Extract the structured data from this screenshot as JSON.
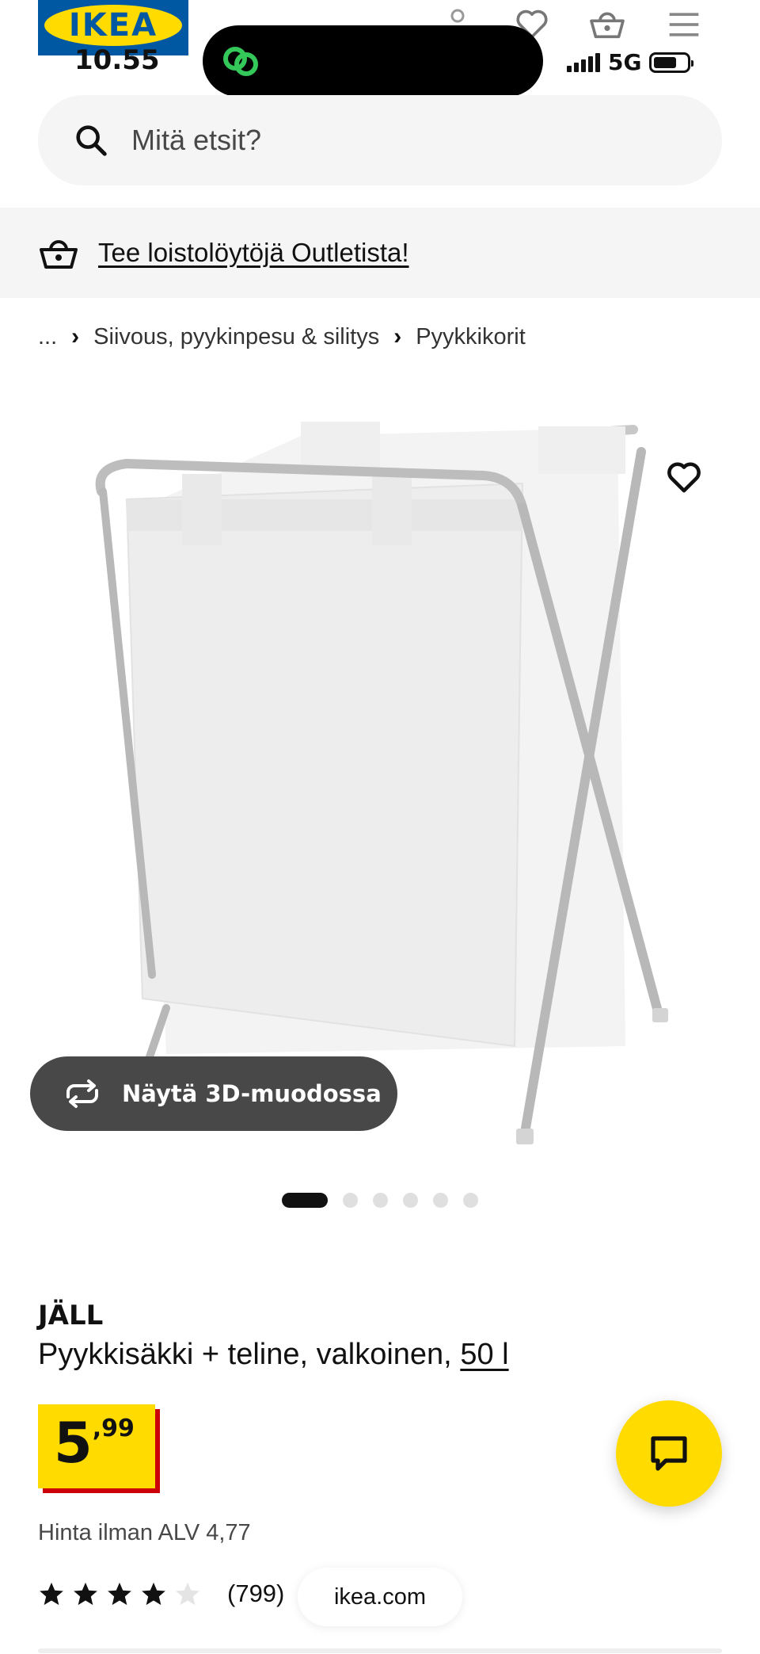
{
  "header": {
    "logo_text": "IKEA",
    "time": "10.55",
    "network": "5G",
    "icons": [
      "user-icon",
      "heart-icon",
      "basket-icon",
      "menu-icon"
    ]
  },
  "search": {
    "placeholder": "Mitä etsit?"
  },
  "banner": {
    "link_text": "Tee loistolöytöjä Outletista!",
    "icon": "basket-icon"
  },
  "breadcrumb": {
    "items": [
      "...",
      "Siivous, pyykinpesu & silitys",
      "Pyykkikorit"
    ]
  },
  "gallery": {
    "button_3d_label": "Näytä 3D-muodossa",
    "slide_count": 6,
    "active_slide": 1
  },
  "product": {
    "name": "JÄLL",
    "description": "Pyykkisäkki + teline, valkoinen,",
    "size_link": "50 l",
    "price_integer": "5",
    "price_decimal": ",99",
    "vat_text": "Hinta ilman ALV 4,77",
    "rating": 4,
    "rating_max": 5,
    "rating_count": "(799)"
  },
  "footer_pill": {
    "label": "ikea.com"
  },
  "colors": {
    "brand_yellow": "#ffdb00",
    "brand_blue": "#0058a3",
    "price_shadow_red": "#cc0008",
    "dark_button": "#484848"
  }
}
